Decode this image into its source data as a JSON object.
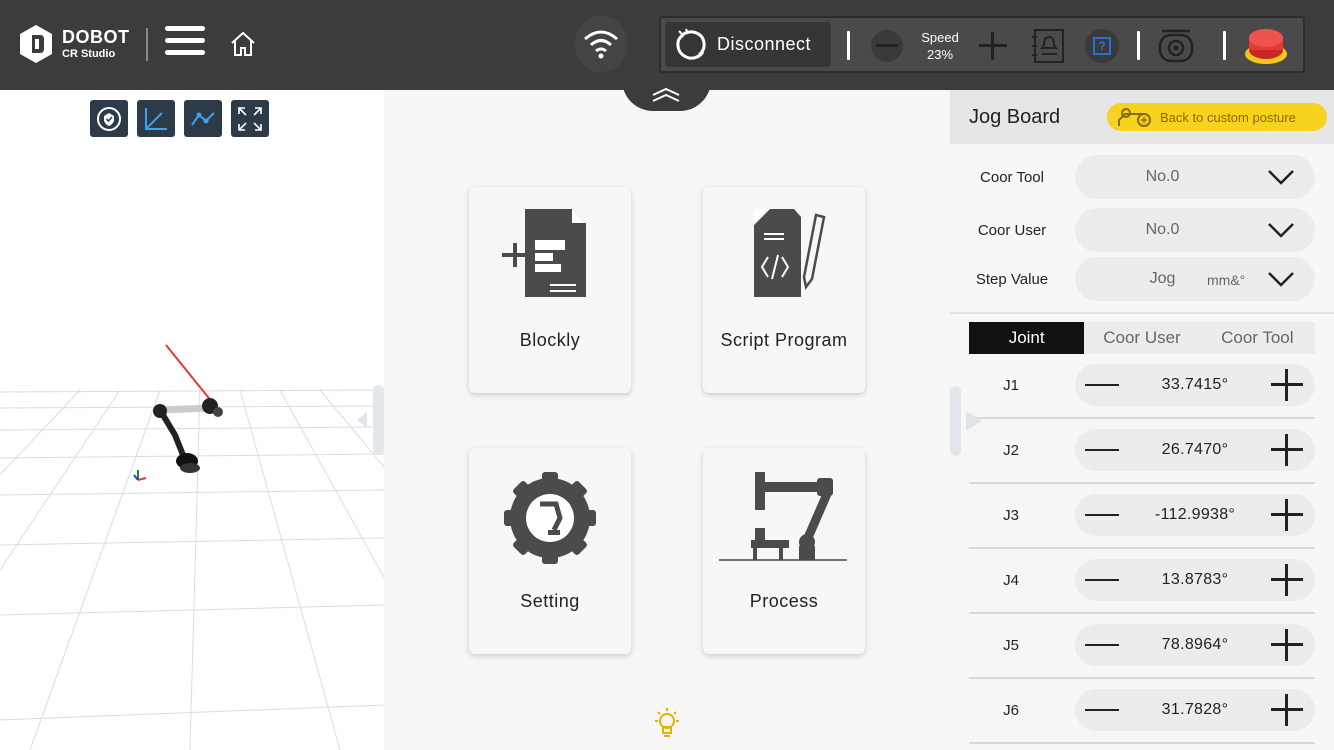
{
  "app": {
    "brand": "DOBOT",
    "product": "CR Studio"
  },
  "toolbar": {
    "disconnect_label": "Disconnect",
    "speed_label": "Speed",
    "speed_value": "23%"
  },
  "cards": {
    "blockly": "Blockly",
    "script": "Script Program",
    "setting": "Setting",
    "process": "Process"
  },
  "jog": {
    "title": "Jog Board",
    "back_label": "Back to custom posture",
    "coor_tool_label": "Coor Tool",
    "coor_tool_value": "No.0",
    "coor_user_label": "Coor User",
    "coor_user_value": "No.0",
    "step_label": "Step Value",
    "step_value": "Jog",
    "step_unit": "mm&°",
    "tabs": [
      "Joint",
      "Coor User",
      "Coor Tool"
    ],
    "joints": [
      {
        "name": "J1",
        "value": "33.7415°"
      },
      {
        "name": "J2",
        "value": "26.7470°"
      },
      {
        "name": "J3",
        "value": "-112.9938°"
      },
      {
        "name": "J4",
        "value": "13.8783°"
      },
      {
        "name": "J5",
        "value": "78.8964°"
      },
      {
        "name": "J6",
        "value": "31.7828°"
      }
    ]
  },
  "colors": {
    "topbar": "#3c3c3c",
    "accent_yellow": "#f5d31e",
    "estop_red": "#e53935",
    "view_tool": "#2d3a48"
  }
}
